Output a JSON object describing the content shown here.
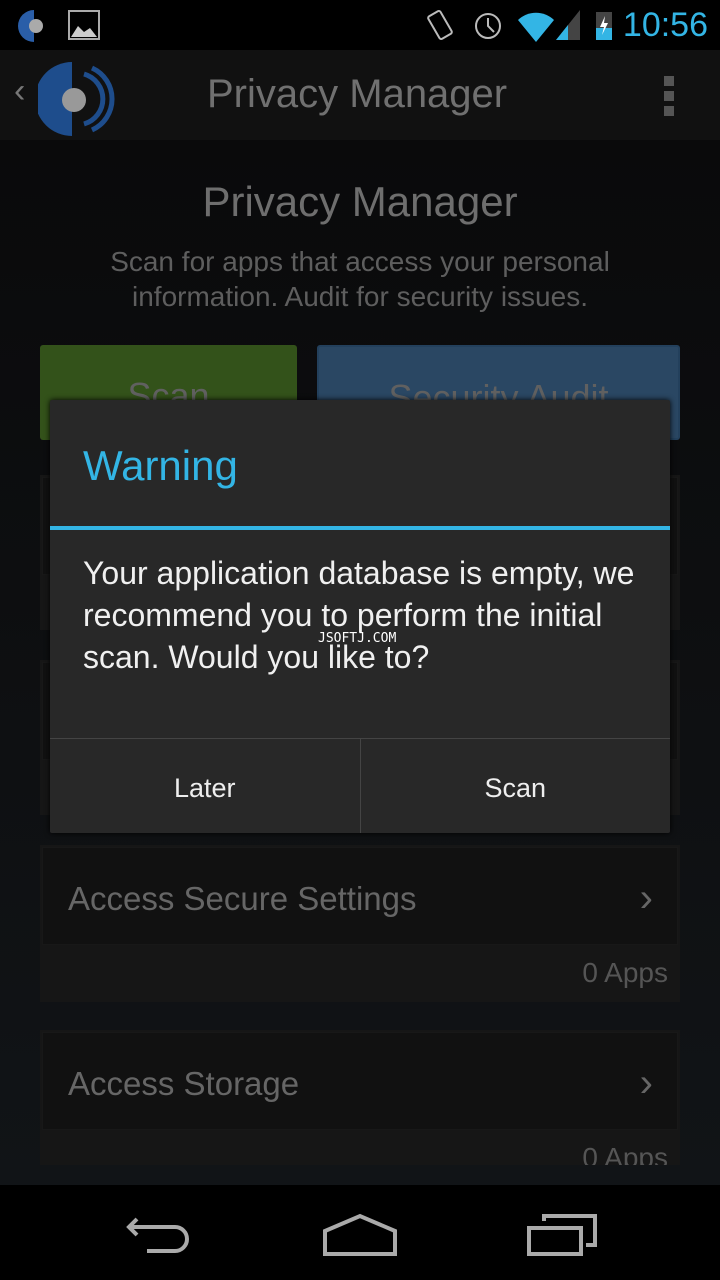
{
  "status_bar": {
    "time": "10:56",
    "icons": [
      "malwarebytes-notification-icon",
      "image-notification-icon",
      "vibrate-icon",
      "alarm-icon",
      "wifi-icon",
      "signal-icon",
      "battery-charging-icon"
    ]
  },
  "action_bar": {
    "title": "Privacy Manager",
    "icons": [
      "back-caret-icon",
      "malwarebytes-logo",
      "overflow-menu-icon"
    ]
  },
  "main": {
    "title": "Privacy Manager",
    "subtitle": "Scan for apps that access your personal information. Audit for security issues.",
    "scan_button": "Scan",
    "audit_button": "Security Audit",
    "cards": [
      {
        "title": "Access Secure Settings",
        "count": "0 Apps"
      },
      {
        "title": "Access Storage",
        "count": "0 Apps"
      }
    ]
  },
  "dialog": {
    "title": "Warning",
    "message": "Your application database is empty, we recommend you to perform the initial scan. Would you like to?",
    "buttons": [
      "Later",
      "Scan"
    ]
  },
  "watermark": "JSOFTJ.COM",
  "colors": {
    "accent": "#33b5e5",
    "scan_green": "#33521a",
    "audit_blue": "#2a4763"
  }
}
